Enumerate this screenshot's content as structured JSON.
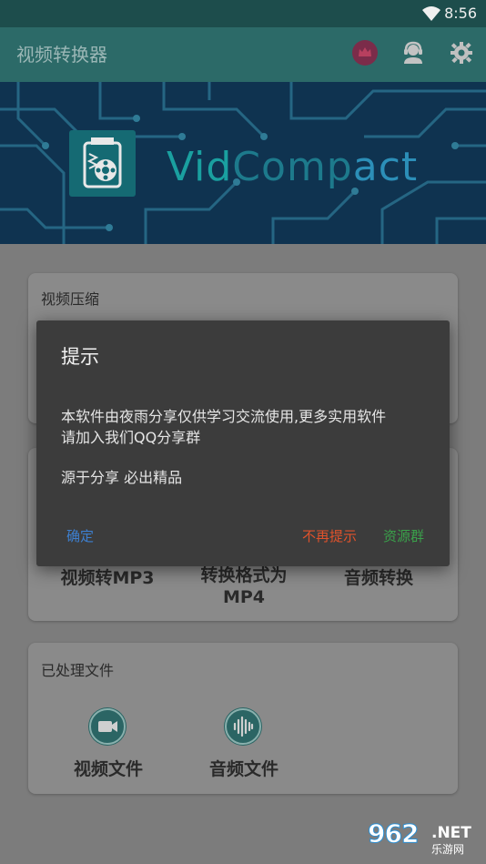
{
  "status_bar": {
    "time": "8:56"
  },
  "app_bar": {
    "title": "视频转换器",
    "icons": [
      "crown-icon",
      "customer-service-icon",
      "gear-icon"
    ]
  },
  "banner": {
    "brand_vid": "Vid",
    "brand_comp": "Comp",
    "brand_act": "act"
  },
  "cards": {
    "compress_title": "视频压缩",
    "tools": [
      "视频转MP3",
      "转换格式为 MP4",
      "音频转换"
    ],
    "processed_title": "已处理文件",
    "processed_items": [
      {
        "label": "视频文件",
        "icon": "video-camera-icon"
      },
      {
        "label": "音频文件",
        "icon": "audio-wave-icon"
      }
    ]
  },
  "dialog": {
    "title": "提示",
    "message_line1": "本软件由夜雨分享仅供学习交流使用,更多实用软件",
    "message_line2": "请加入我们QQ分享群",
    "message2": "源于分享 必出精品",
    "ok": "确定",
    "dont_show": "不再提示",
    "group": "资源群"
  },
  "watermark": {
    "num": "962",
    "net": ".NET",
    "sub": "乐游网"
  },
  "colors": {
    "appbar": "#2c6a68",
    "ok": "#3d7fcf",
    "dont_show": "#e0522b",
    "group": "#3aa04a"
  }
}
